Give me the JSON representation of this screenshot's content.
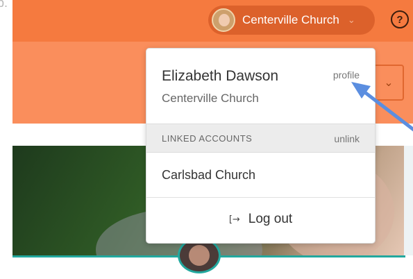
{
  "clipped_text": "p.",
  "header": {
    "account_name": "Centerville Church",
    "help_icon": "?"
  },
  "subheader": {
    "button_icon": "chevron-down-icon"
  },
  "dropdown": {
    "user_name": "Elizabeth Dawson",
    "user_church": "Centerville Church",
    "profile_link": "profile",
    "linked_accounts_label": "LINKED ACCOUNTS",
    "unlink_label": "unlink",
    "linked_accounts": [
      "Carlsbad Church"
    ],
    "logout_label": "Log out"
  },
  "colors": {
    "topbar": "#f57a3f",
    "subbar": "#fa8e5c",
    "account_pill": "#dc612b",
    "arrow": "#5b8ee0",
    "teal_accent": "#22a89e"
  }
}
